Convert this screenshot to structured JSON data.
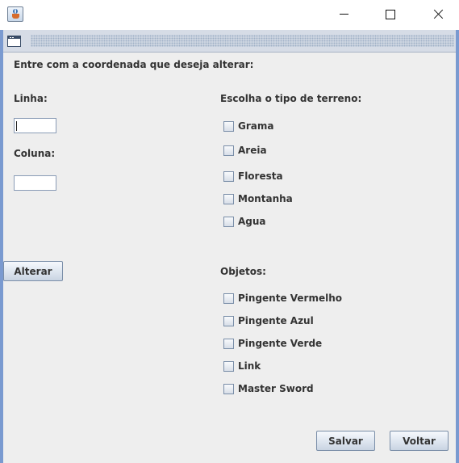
{
  "window": {
    "title": ""
  },
  "form": {
    "heading": "Entre com a coordenada que deseja alterar:",
    "row_label": "Linha:",
    "row_value": "",
    "column_label": "Coluna:",
    "column_value": "",
    "alter_button": "Alterar"
  },
  "terrain": {
    "title": "Escolha o tipo de terreno:",
    "options": [
      {
        "label": "Grama",
        "checked": false
      },
      {
        "label": "Areia",
        "checked": false
      },
      {
        "label": "Floresta",
        "checked": false
      },
      {
        "label": "Montanha",
        "checked": false
      },
      {
        "label": "Agua",
        "checked": false
      }
    ]
  },
  "objects": {
    "title": "Objetos:",
    "options": [
      {
        "label": "Pingente Vermelho",
        "checked": false
      },
      {
        "label": "Pingente Azul",
        "checked": false
      },
      {
        "label": "Pingente Verde",
        "checked": false
      },
      {
        "label": "Link",
        "checked": false
      },
      {
        "label": "Master Sword",
        "checked": false
      }
    ]
  },
  "actions": {
    "save": "Salvar",
    "back": "Voltar"
  },
  "colors": {
    "frame_border": "#7a9ad0",
    "panel_bg": "#eeeeee",
    "text": "#333333"
  },
  "icons": {
    "app": "java-cup-icon",
    "frame": "window-icon"
  }
}
